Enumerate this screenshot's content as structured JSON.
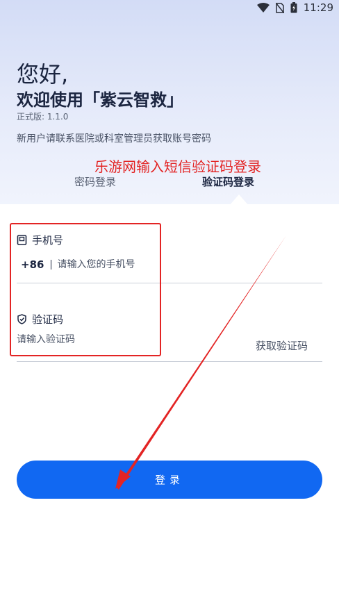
{
  "status_bar": {
    "time": "11:29"
  },
  "header": {
    "greeting": "您好,",
    "welcome": "欢迎使用「紫云智救」",
    "version": "正式版: 1.1.0",
    "notice": "新用户请联系医院或科室管理员获取账号密码"
  },
  "annotation": {
    "text": "乐游网输入短信验证码登录"
  },
  "tabs": {
    "password": "密码登录",
    "sms": "验证码登录"
  },
  "phone_field": {
    "label": "手机号",
    "country_code": "+86",
    "placeholder": "请输入您的手机号"
  },
  "code_field": {
    "label": "验证码",
    "placeholder": "请输入验证码",
    "get_code": "获取验证码"
  },
  "login": {
    "label": "登录"
  },
  "colors": {
    "accent": "#1168f2",
    "annotation": "#e32424"
  }
}
